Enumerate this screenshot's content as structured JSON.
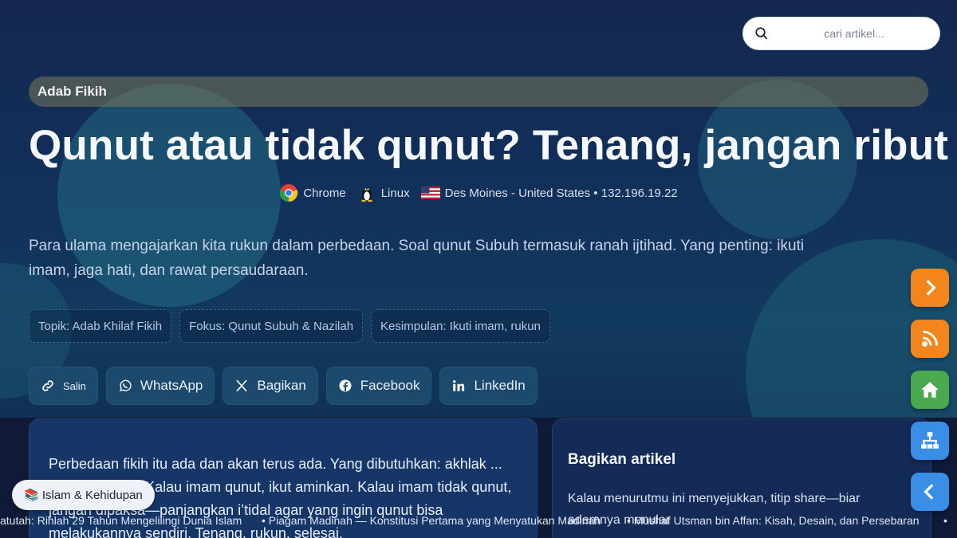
{
  "search": {
    "placeholder": "cari artikel..."
  },
  "category": "Adab Fikih",
  "title": "Qunut atau tidak qunut? Tenang, jangan ribut",
  "meta": {
    "browser": "Chrome",
    "os": "Linux",
    "location": "Des Moines - United States • 132.196.19.22"
  },
  "lead": "Para ulama mengajarkan kita rukun dalam perbedaan. Soal qunut Subuh termasuk ranah ijtihad. Yang penting: ikuti imam, jaga hati, dan rawat persaudaraan.",
  "chips": [
    "Topik: Adab Khilaf Fikih",
    "Fokus: Qunut Subuh & Nazilah",
    "Kesimpulan: Ikuti imam, rukun"
  ],
  "share_buttons": [
    "Salin",
    "WhatsApp",
    "Bagikan",
    "Facebook",
    "LinkedIn"
  ],
  "article_body": "Perbedaan fikih itu ada dan akan terus ada. Yang dibutuhkan: akhlak ... Qunut Subuh? Kalau imam qunut, ikut aminkan. Kalau imam tidak qunut, jangan dipaksa—panjangkan i’tidal agar yang ingin qunut bisa melakukannya sendiri. Tenang, rukun, selesai.",
  "share_card": {
    "title": "Bagikan artikel",
    "text": "Kalau menurutmu ini menyejukkan, titip share—biar ademnya menular"
  },
  "category_pill": "📚 Islam & Kehidupan",
  "ticker": [
    "atutah: Rihlah 29 Tahun Mengelilingi Dunia Islam",
    "• Piagam Madinah — Konstitusi Pertama yang Menyatukan Madinah",
    "• Mushaf Utsman bin Affan: Kisah, Desain, dan Persebaran",
    "•"
  ],
  "colors": {
    "fab_next": "#f2861c",
    "fab_rss": "#f2861c",
    "fab_home": "#4aa84e",
    "fab_sitemap": "#3b8ee6",
    "fab_back": "#3b8ee6"
  }
}
